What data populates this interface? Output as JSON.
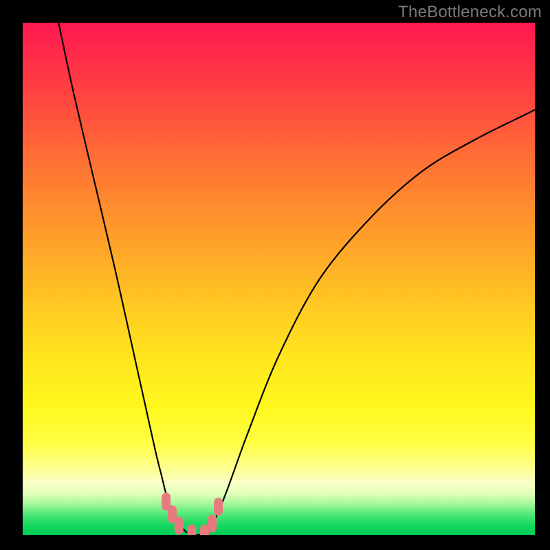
{
  "watermark": "TheBottleneck.com",
  "chart_data": {
    "type": "line",
    "title": "",
    "xlabel": "",
    "ylabel": "",
    "xlim": [
      0,
      100
    ],
    "ylim": [
      0,
      100
    ],
    "series": [
      {
        "name": "curve-left",
        "x": [
          7,
          10,
          14,
          18,
          22,
          24,
          26,
          27,
          28,
          29,
          30,
          31,
          32
        ],
        "y": [
          100,
          86,
          69,
          52,
          34,
          25,
          16,
          12,
          8,
          5,
          3,
          1.5,
          0.5
        ]
      },
      {
        "name": "curve-right",
        "x": [
          36,
          37,
          38,
          40,
          44,
          50,
          58,
          68,
          78,
          88,
          98,
          100
        ],
        "y": [
          0.5,
          2,
          4,
          9,
          20,
          35,
          50,
          62,
          71,
          77,
          82,
          83
        ]
      },
      {
        "name": "trough",
        "x": [
          32,
          33,
          34,
          35,
          36
        ],
        "y": [
          0.5,
          0,
          0,
          0,
          0.5
        ]
      }
    ],
    "markers": {
      "name": "highlight-points",
      "points": [
        {
          "x": 28.0,
          "y": 6.5
        },
        {
          "x": 29.2,
          "y": 4.0
        },
        {
          "x": 30.5,
          "y": 1.8
        },
        {
          "x": 33.0,
          "y": 0.3
        },
        {
          "x": 35.5,
          "y": 0.3
        },
        {
          "x": 37.0,
          "y": 2.2
        },
        {
          "x": 38.2,
          "y": 5.5
        }
      ]
    },
    "gradient_stops": [
      {
        "pos": 0.0,
        "color": "#ff1850"
      },
      {
        "pos": 0.5,
        "color": "#ffb024"
      },
      {
        "pos": 0.82,
        "color": "#fffe42"
      },
      {
        "pos": 1.0,
        "color": "#00ce58"
      }
    ]
  }
}
